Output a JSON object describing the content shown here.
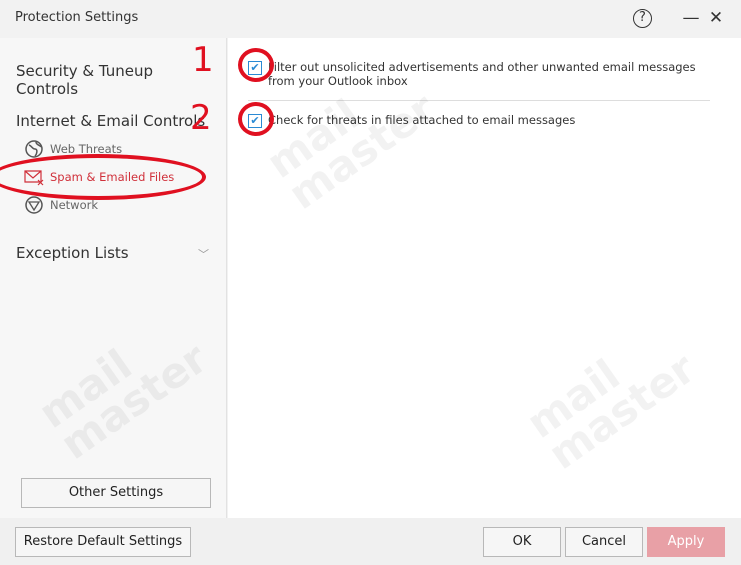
{
  "window": {
    "title": "Protection Settings",
    "help_icon": "?",
    "minimize_icon": "—",
    "close_icon": "✕"
  },
  "sidebar": {
    "sections": [
      {
        "label": "Security & Tuneup Controls"
      },
      {
        "label": "Internet & Email Controls"
      },
      {
        "label": "Exception Lists"
      }
    ],
    "subitems": [
      {
        "label": "Web Threats",
        "icon": "globe-icon"
      },
      {
        "label": "Spam & Emailed Files",
        "icon": "envelope-x-icon",
        "active": true
      },
      {
        "label": "Network",
        "icon": "network-icon"
      }
    ],
    "other_settings": "Other Settings"
  },
  "main": {
    "options": [
      {
        "label": "Filter out unsolicited advertisements and other unwanted email messages from your Outlook inbox",
        "checked": true
      },
      {
        "label": "Check for threats in files attached to email messages",
        "checked": true
      }
    ]
  },
  "footer": {
    "restore": "Restore Default Settings",
    "ok": "OK",
    "cancel": "Cancel",
    "apply": "Apply"
  },
  "annotations": {
    "one": "1",
    "two": "2",
    "color": "#e01020"
  },
  "watermark": "mail master",
  "colors": {
    "accent": "#d0303a",
    "checkbox": "#2a8ad4",
    "apply_disabled": "#e8a0a6"
  }
}
